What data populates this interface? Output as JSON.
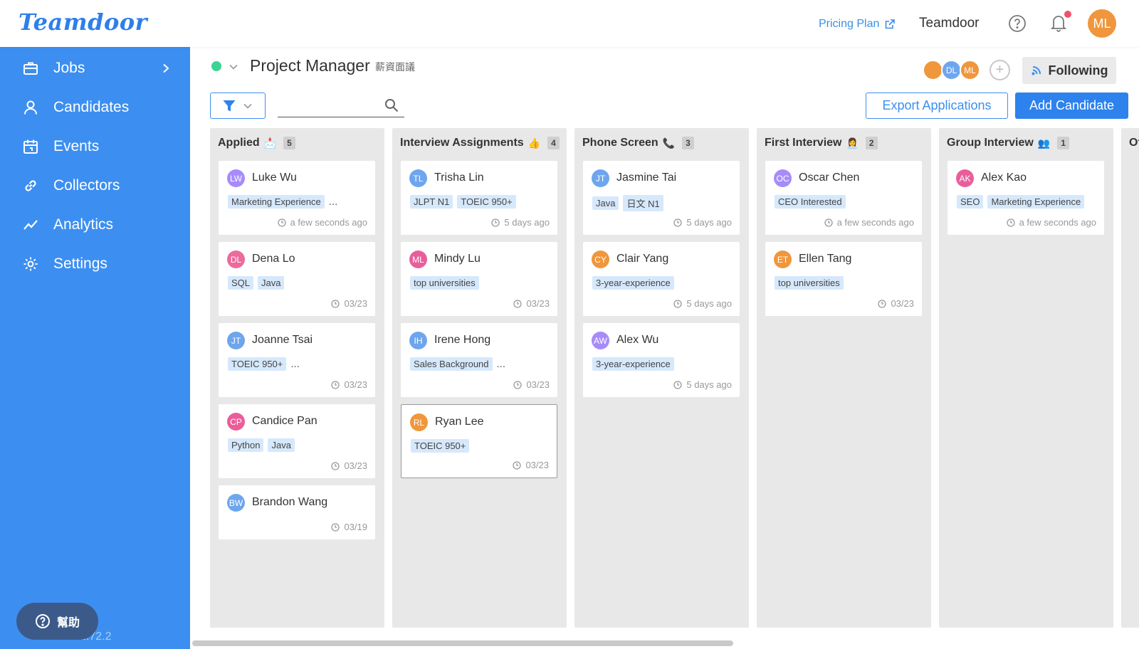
{
  "app": {
    "logo": "Teamdoor",
    "pricing_label": "Pricing Plan",
    "workspace": "Teamdoor",
    "user_initials": "ML",
    "accent_color": "#3c8ff0"
  },
  "sidebar": {
    "items": [
      {
        "label": "Jobs",
        "icon": "briefcase-icon"
      },
      {
        "label": "Candidates",
        "icon": "person-icon"
      },
      {
        "label": "Events",
        "icon": "calendar-icon"
      },
      {
        "label": "Collectors",
        "icon": "link-icon"
      },
      {
        "label": "Analytics",
        "icon": "trend-icon"
      },
      {
        "label": "Settings",
        "icon": "gear-icon"
      }
    ],
    "help_label": "幫助",
    "version": "1.72.2"
  },
  "job": {
    "title": "Project Manager",
    "subtitle": "薪資面議",
    "team": [
      "",
      "DL",
      "ML"
    ],
    "following_label": "Following"
  },
  "toolbar": {
    "search_placeholder": "",
    "export_label": "Export Applications",
    "add_label": "Add Candidate"
  },
  "columns": [
    {
      "name": "Applied",
      "emoji": "📩",
      "count": "5",
      "cards": [
        {
          "initials": "LW",
          "name": "Luke Wu",
          "tags": [
            "Marketing Experience"
          ],
          "more": "...",
          "time": "a few seconds ago",
          "color": "#a78bfa"
        },
        {
          "initials": "DL",
          "name": "Dena Lo",
          "tags": [
            "SQL",
            "Java"
          ],
          "more": "",
          "time": "03/23",
          "color": "#ec6a9c"
        },
        {
          "initials": "JT",
          "name": "Joanne Tsai",
          "tags": [
            "TOEIC 950+"
          ],
          "more": "...",
          "time": "03/23",
          "color": "#6ea6ee"
        },
        {
          "initials": "CP",
          "name": "Candice Pan",
          "tags": [
            "Python",
            "Java"
          ],
          "more": "",
          "time": "03/23",
          "color": "#e95e9a"
        },
        {
          "initials": "BW",
          "name": "Brandon Wang",
          "tags": [],
          "more": "",
          "time": "03/19",
          "color": "#6ea6ee"
        }
      ]
    },
    {
      "name": "Interview Assignments",
      "emoji": "👍",
      "count": "4",
      "cards": [
        {
          "initials": "TL",
          "name": "Trisha Lin",
          "tags": [
            "JLPT N1",
            "TOEIC 950+"
          ],
          "more": "",
          "time": "5 days ago",
          "color": "#6ea6ee"
        },
        {
          "initials": "ML",
          "name": "Mindy Lu",
          "tags": [
            "top universities"
          ],
          "more": "",
          "time": "03/23",
          "color": "#e95e9a"
        },
        {
          "initials": "IH",
          "name": "Irene Hong",
          "tags": [
            "Sales Background"
          ],
          "more": "...",
          "time": "03/23",
          "color": "#6ea6ee"
        },
        {
          "initials": "RL",
          "name": "Ryan Lee",
          "tags": [
            "TOEIC 950+"
          ],
          "more": "",
          "time": "03/23",
          "color": "#f0963c"
        }
      ]
    },
    {
      "name": "Phone Screen",
      "emoji": "📞",
      "count": "3",
      "cards": [
        {
          "initials": "JT",
          "name": "Jasmine Tai",
          "tags": [
            "Java",
            "日文 N1"
          ],
          "more": "",
          "time": "5 days ago",
          "color": "#6ea6ee"
        },
        {
          "initials": "CY",
          "name": "Clair Yang",
          "tags": [
            "3-year-experience"
          ],
          "more": "",
          "time": "5 days ago",
          "color": "#f0963c"
        },
        {
          "initials": "AW",
          "name": "Alex Wu",
          "tags": [
            "3-year-experience"
          ],
          "more": "",
          "time": "5 days ago",
          "color": "#a78bfa"
        }
      ]
    },
    {
      "name": "First Interview",
      "emoji": "👩‍💼",
      "count": "2",
      "cards": [
        {
          "initials": "OC",
          "name": "Oscar Chen",
          "tags": [
            "CEO Interested"
          ],
          "more": "",
          "time": "a few seconds ago",
          "color": "#a78bfa"
        },
        {
          "initials": "ET",
          "name": "Ellen Tang",
          "tags": [
            "top universities"
          ],
          "more": "",
          "time": "03/23",
          "color": "#f0963c"
        }
      ]
    },
    {
      "name": "Group Interview",
      "emoji": "👥",
      "count": "1",
      "cards": [
        {
          "initials": "AK",
          "name": "Alex Kao",
          "tags": [
            "SEO",
            "Marketing Experience"
          ],
          "more": "",
          "time": "a few seconds ago",
          "color": "#e95e9a"
        }
      ]
    },
    {
      "name": "Of",
      "emoji": "",
      "count": "",
      "cards": []
    }
  ]
}
